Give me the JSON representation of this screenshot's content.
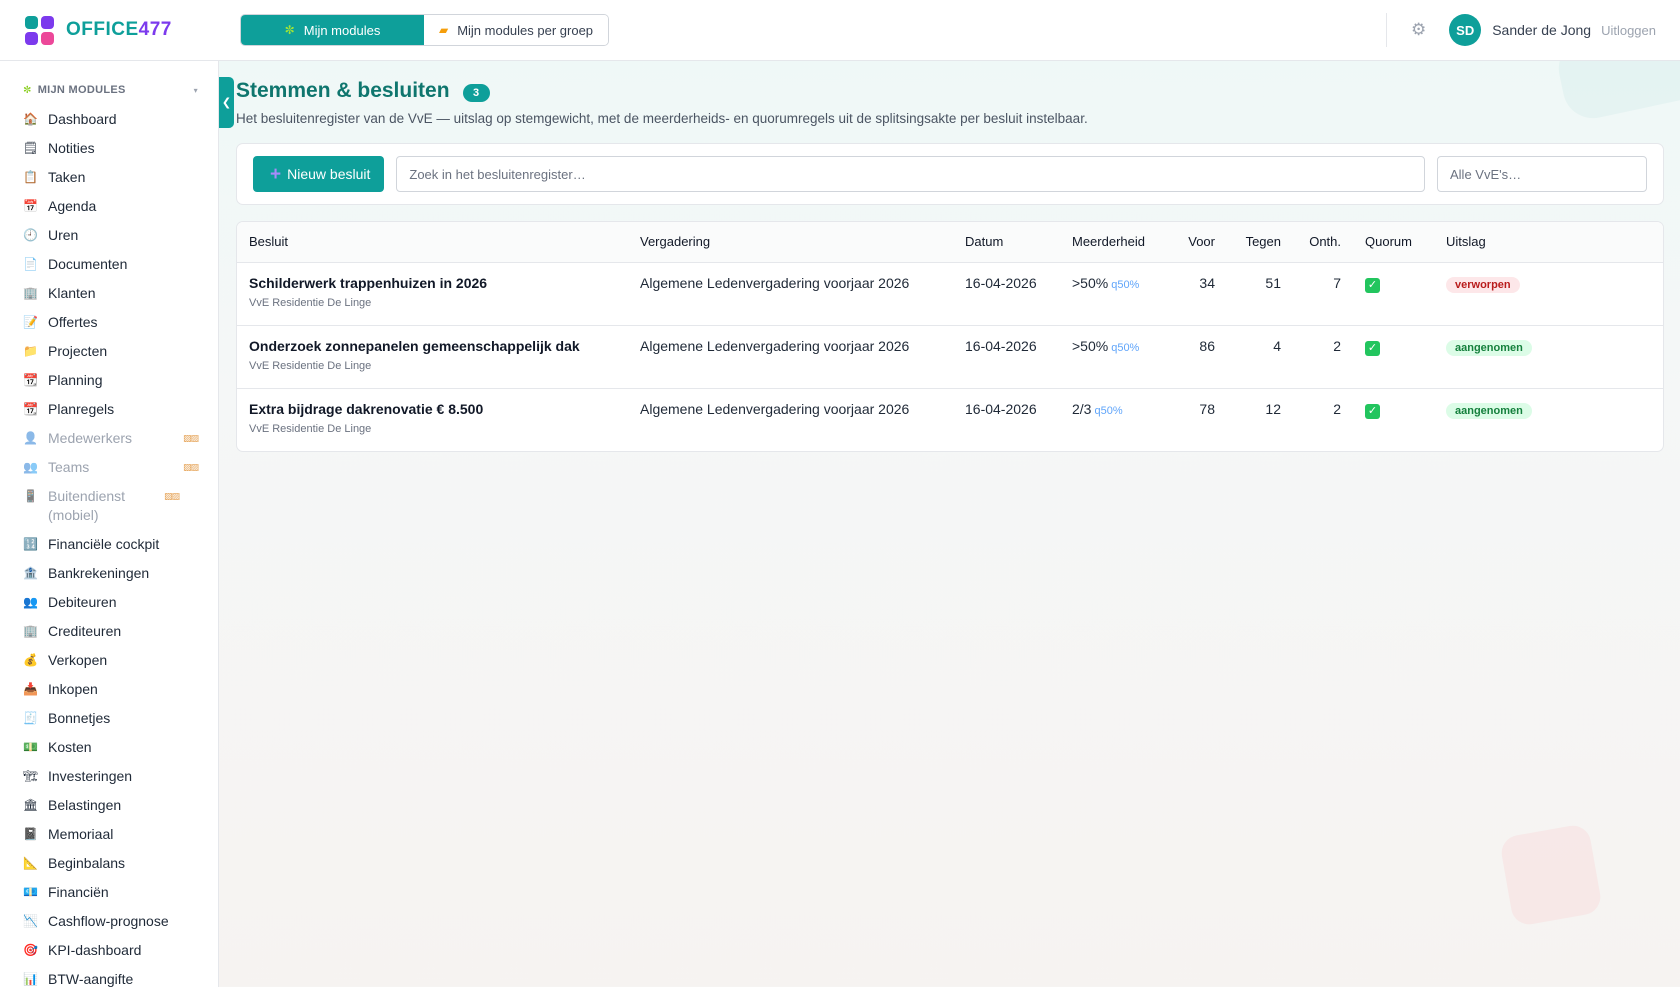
{
  "brand": {
    "name_prefix": "OFFICE",
    "name_number": "477",
    "colors": {
      "teal": "#0e9f9a",
      "purple": "#7c3aed",
      "pink": "#ec4899",
      "green_check": "#22c55e"
    }
  },
  "module_tabs": [
    {
      "label": "Mijn modules",
      "icon": "puzzle-icon",
      "glyph": "✼",
      "active": true
    },
    {
      "label": "Mijn modules per groep",
      "icon": "folder-icon",
      "glyph": "📁",
      "active": false
    }
  ],
  "user": {
    "initials": "SD",
    "name": "Sander de Jong",
    "logout_label": "Uitloggen"
  },
  "sidebar": {
    "section_label": "MIJN MODULES",
    "items": [
      {
        "label": "Dashboard",
        "icon": "house-icon",
        "glyph": "🏠",
        "locked": false
      },
      {
        "label": "Notities",
        "icon": "note-icon",
        "glyph": "🗒",
        "locked": false
      },
      {
        "label": "Taken",
        "icon": "clipboard-icon",
        "glyph": "📋",
        "locked": false
      },
      {
        "label": "Agenda",
        "icon": "calendar-icon",
        "glyph": "📅",
        "locked": false
      },
      {
        "label": "Uren",
        "icon": "clock-icon",
        "glyph": "🕘",
        "locked": false
      },
      {
        "label": "Documenten",
        "icon": "document-icon",
        "glyph": "📄",
        "locked": false
      },
      {
        "label": "Klanten",
        "icon": "building-icon",
        "glyph": "🏢",
        "locked": false
      },
      {
        "label": "Offertes",
        "icon": "memo-icon",
        "glyph": "📝",
        "locked": false
      },
      {
        "label": "Projecten",
        "icon": "folder-icon",
        "glyph": "📁",
        "locked": false
      },
      {
        "label": "Planning",
        "icon": "calendar-icon",
        "glyph": "📆",
        "locked": false
      },
      {
        "label": "Planregels",
        "icon": "calendar-icon",
        "glyph": "📆",
        "locked": false
      },
      {
        "label": "Medewerkers",
        "icon": "person-icon",
        "glyph": "👤",
        "locked": true
      },
      {
        "label": "Teams",
        "icon": "people-icon",
        "glyph": "👥",
        "locked": true
      },
      {
        "label": "Buitendienst (mobiel)",
        "icon": "phone-icon",
        "glyph": "📱",
        "locked": true
      },
      {
        "label": "Financiële cockpit",
        "icon": "grid-icon",
        "glyph": "🔢",
        "locked": false
      },
      {
        "label": "Bankrekeningen",
        "icon": "bank-icon",
        "glyph": "🏦",
        "locked": false
      },
      {
        "label": "Debiteuren",
        "icon": "people-icon",
        "glyph": "👥",
        "locked": false
      },
      {
        "label": "Crediteuren",
        "icon": "building-icon",
        "glyph": "🏢",
        "locked": false
      },
      {
        "label": "Verkopen",
        "icon": "money-bag-icon",
        "glyph": "💰",
        "locked": false
      },
      {
        "label": "Inkopen",
        "icon": "inbox-icon",
        "glyph": "📥",
        "locked": false
      },
      {
        "label": "Bonnetjes",
        "icon": "receipt-icon",
        "glyph": "🧾",
        "locked": false
      },
      {
        "label": "Kosten",
        "icon": "banknote-icon",
        "glyph": "💵",
        "locked": false
      },
      {
        "label": "Investeringen",
        "icon": "crane-icon",
        "glyph": "🏗",
        "locked": false
      },
      {
        "label": "Belastingen",
        "icon": "government-icon",
        "glyph": "🏛",
        "locked": false
      },
      {
        "label": "Memoriaal",
        "icon": "notebook-icon",
        "glyph": "📓",
        "locked": false
      },
      {
        "label": "Beginbalans",
        "icon": "ruler-icon",
        "glyph": "📐",
        "locked": false
      },
      {
        "label": "Financiën",
        "icon": "banknote-icon",
        "glyph": "💶",
        "locked": false
      },
      {
        "label": "Cashflow-prognose",
        "icon": "chart-down-icon",
        "glyph": "📉",
        "locked": false
      },
      {
        "label": "KPI-dashboard",
        "icon": "target-icon",
        "glyph": "🎯",
        "locked": false
      },
      {
        "label": "BTW-aangifte",
        "icon": "chart-icon",
        "glyph": "📊",
        "locked": false
      }
    ]
  },
  "page": {
    "title": "Stemmen & besluiten",
    "count": "3",
    "subtitle": "Het besluitenregister van de VvE — uitslag op stemgewicht, met de meerderheids- en quorumregels uit de splitsingsakte per besluit instelbaar."
  },
  "toolbar": {
    "new_label": "Nieuw besluit",
    "search_placeholder": "Zoek in het besluitenregister…",
    "vve_select_value": "Alle VvE's…"
  },
  "table": {
    "headers": [
      "Besluit",
      "Vergadering",
      "Datum",
      "Meerderheid",
      "Voor",
      "Tegen",
      "Onth.",
      "Quorum",
      "Uitslag"
    ],
    "rows": [
      {
        "title": "Schilderwerk trappenhuizen in 2026",
        "vve": "VvE Residentie De Linge",
        "meeting": "Algemene Ledenvergadering voorjaar 2026",
        "date": "16-04-2026",
        "majority": ">50%",
        "quorum_rule": "q50%",
        "for": "34",
        "against": "51",
        "abstain": "7",
        "quorum_met": true,
        "result": "verworpen",
        "result_type": "neg"
      },
      {
        "title": "Onderzoek zonnepanelen gemeenschappelijk dak",
        "vve": "VvE Residentie De Linge",
        "meeting": "Algemene Ledenvergadering voorjaar 2026",
        "date": "16-04-2026",
        "majority": ">50%",
        "quorum_rule": "q50%",
        "for": "86",
        "against": "4",
        "abstain": "2",
        "quorum_met": true,
        "result": "aangenomen",
        "result_type": "pos"
      },
      {
        "title": "Extra bijdrage dakrenovatie € 8.500",
        "vve": "VvE Residentie De Linge",
        "meeting": "Algemene Ledenvergadering voorjaar 2026",
        "date": "16-04-2026",
        "majority": "2/3",
        "quorum_rule": "q50%",
        "for": "78",
        "against": "12",
        "abstain": "2",
        "quorum_met": true,
        "result": "aangenomen",
        "result_type": "pos"
      }
    ]
  }
}
